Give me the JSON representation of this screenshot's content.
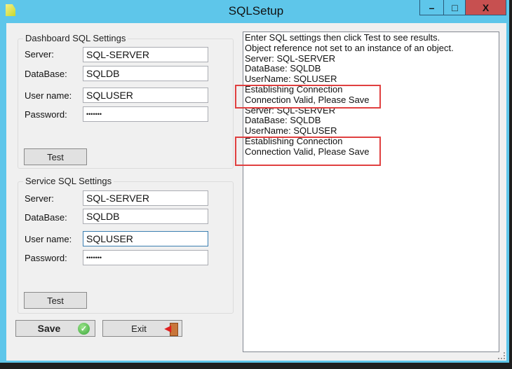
{
  "window": {
    "title": "SQLSetup",
    "controls": [
      "–",
      "□",
      "X"
    ]
  },
  "dashboard": {
    "title": "Dashboard SQL Settings",
    "server_label": "Server:",
    "server": "SQL-SERVER",
    "database_label": "DataBase:",
    "database": "SQLDB",
    "user_label": "User name:",
    "user": "SQLUSER",
    "password_label": "Password:",
    "password": "•••••••",
    "test": "Test"
  },
  "service": {
    "title": "Service SQL Settings",
    "server_label": "Server:",
    "server": "SQL-SERVER",
    "database_label": "DataBase:",
    "database": "SQLDB",
    "user_label": "User name:",
    "user": "SQLUSER",
    "password_label": "Password:",
    "password": "•••••••",
    "test": "Test"
  },
  "buttons": {
    "save": "Save",
    "exit": "Exit"
  },
  "output": [
    "Enter SQL settings then click Test to see results.",
    "Object reference not set to an instance of an object.",
    "Server: SQL-SERVER",
    "DataBase: SQLDB",
    "UserName: SQLUSER",
    "Establishing Connection",
    "Connection Valid, Please Save",
    "Server: SQL-SERVER",
    "DataBase: SQLDB",
    "UserName: SQLUSER",
    "Establishing Connection",
    "Connection Valid, Please Save"
  ],
  "colors": {
    "frame": "#5ec6ea",
    "close": "#c75050",
    "highlight": "#e04040"
  }
}
